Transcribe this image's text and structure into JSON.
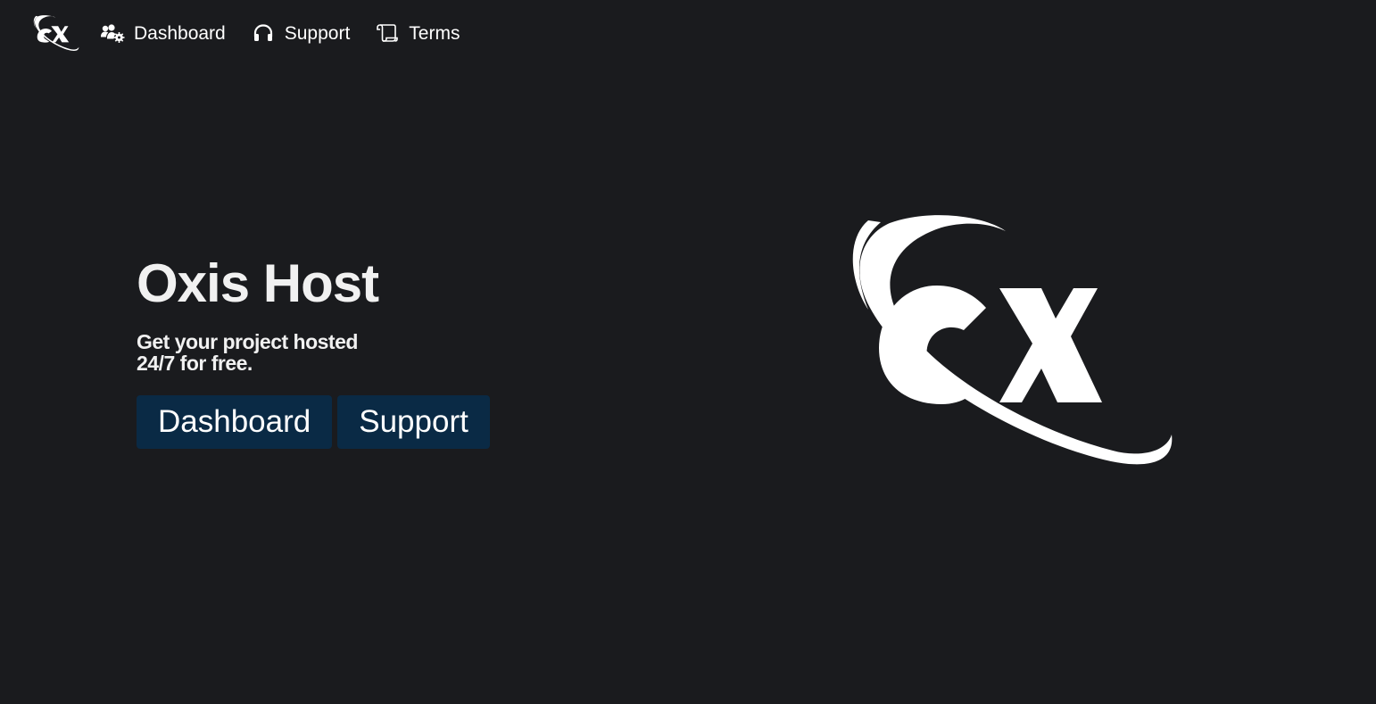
{
  "brand": {
    "logo_text": "OX",
    "logo_icon": "ox-logo-icon"
  },
  "nav": {
    "items": [
      {
        "label": "Dashboard",
        "icon": "users-gear-icon"
      },
      {
        "label": "Support",
        "icon": "headphones-icon"
      },
      {
        "label": "Terms",
        "icon": "scroll-icon"
      }
    ]
  },
  "hero": {
    "title": "Oxis Host",
    "subtitle": "Get your project hosted 24/7 for free.",
    "buttons": {
      "dashboard_label": "Dashboard",
      "support_label": "Support"
    }
  },
  "colors": {
    "background": "#1a1b1e",
    "button_bg": "#0a2a45",
    "text": "#ffffff"
  }
}
